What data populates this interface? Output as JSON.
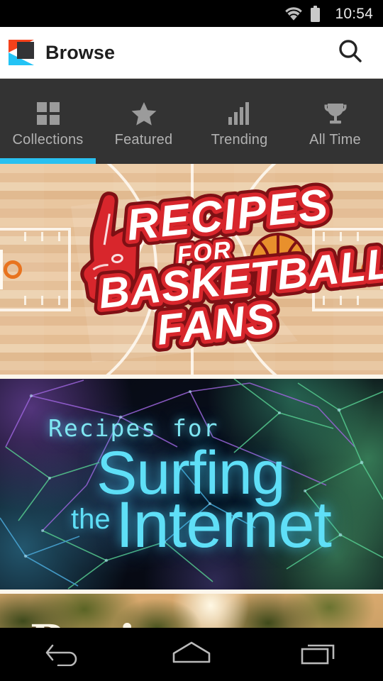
{
  "status_bar": {
    "time": "10:54",
    "icons": [
      "wifi-icon",
      "battery-icon"
    ]
  },
  "app_bar": {
    "logo": "app-logo-icon",
    "title": "Browse",
    "search": "search-icon",
    "colors": {
      "logo_orange": "#f5411b",
      "logo_cyan": "#23c3f5",
      "logo_dark": "#333336",
      "background": "#ffffff",
      "title_color": "#1e1e1e"
    }
  },
  "tabs": {
    "selected_index": 0,
    "indicator_color": "#29c0f0",
    "bar_background": "#333333",
    "items": [
      {
        "label": "Collections",
        "icon": "grid-icon",
        "selected": true
      },
      {
        "label": "Featured",
        "icon": "star-icon",
        "selected": false
      },
      {
        "label": "Trending",
        "icon": "bar-chart-icon",
        "selected": false
      },
      {
        "label": "All Time",
        "icon": "trophy-icon",
        "selected": false
      }
    ]
  },
  "cards": [
    {
      "id": "basketball",
      "title_lines": [
        "RECIPES",
        "FOR",
        "BASKETBALL",
        "FANS"
      ],
      "full_title": "Recipes for Basketball Fans",
      "artwork": "basketball-court-with-foam-finger-and-ball",
      "colors": {
        "court": "#e6bf95",
        "title_red": "#d8262c",
        "title_white": "#ffffff",
        "ball_orange": "#e8902c",
        "rim_orange": "#e8731e"
      }
    },
    {
      "id": "internet",
      "title_lines": [
        "Recipes for",
        "Surfing",
        "the",
        "Internet"
      ],
      "full_title": "Recipes for Surfing the Internet",
      "artwork": "dark-network-constellation-nodes",
      "colors": {
        "background": "#080b14",
        "text_cyan": "#5fdff7",
        "accent_green": "#5cd48c",
        "accent_purple": "#925ad2"
      }
    },
    {
      "id": "nature",
      "title_lines": [
        "Recipes"
      ],
      "full_title": "Recipes",
      "artwork": "forest-foliage-painted",
      "colors": {
        "background": "#d9a96e",
        "leaf_green": "#4a5420",
        "text": "#fdf6e6"
      }
    }
  ],
  "nav_bar": {
    "buttons": [
      {
        "name": "back-button",
        "icon": "back-arrow-icon"
      },
      {
        "name": "home-button",
        "icon": "home-icon"
      },
      {
        "name": "recent-apps-button",
        "icon": "recent-apps-icon"
      }
    ],
    "background": "#000000"
  }
}
